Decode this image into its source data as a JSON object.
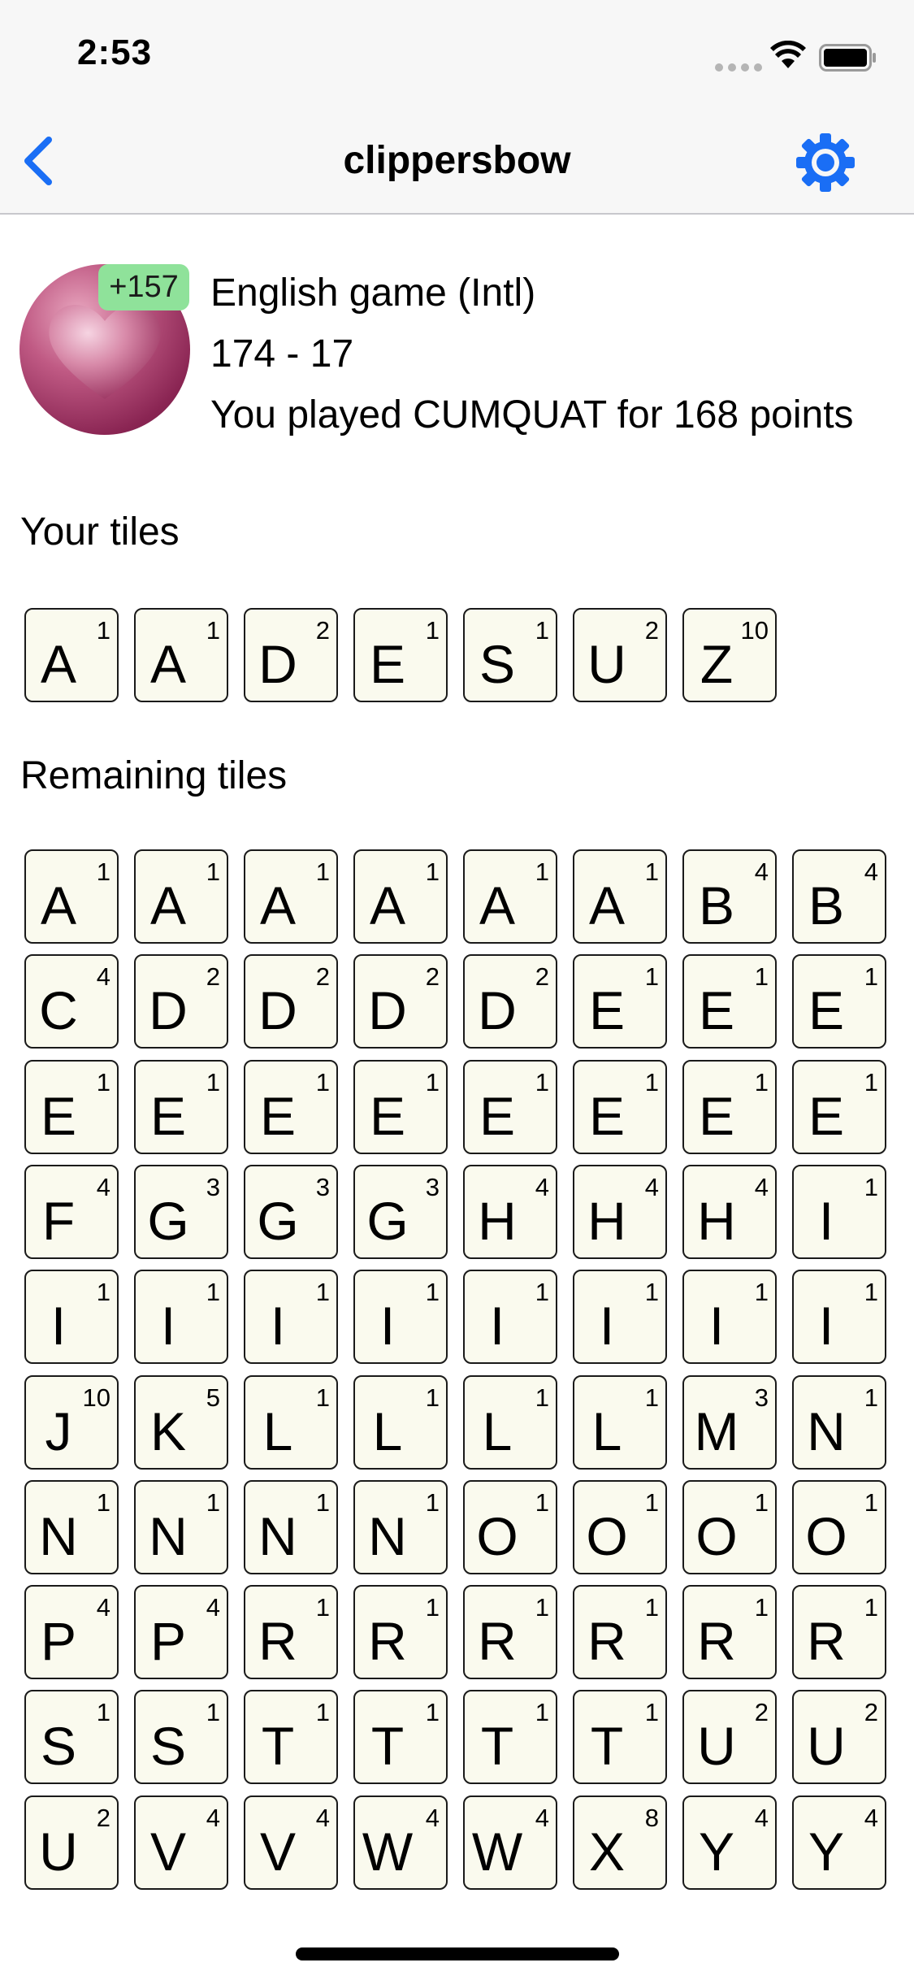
{
  "status_bar": {
    "time": "2:53"
  },
  "nav": {
    "title": "clippersbow",
    "back_icon": "chevron-left-icon",
    "settings_icon": "gear-icon"
  },
  "colors": {
    "accent": "#1a6ef5",
    "badge": "#8fe29a",
    "tile_bg": "#fafaee"
  },
  "game": {
    "score_delta": "+157",
    "name": "English game (Intl)",
    "score": "174 - 17",
    "last_move": "You played CUMQUAT for 168 points"
  },
  "your_tiles": {
    "heading": "Your tiles",
    "tiles": [
      {
        "letter": "A",
        "value": "1"
      },
      {
        "letter": "A",
        "value": "1"
      },
      {
        "letter": "D",
        "value": "2"
      },
      {
        "letter": "E",
        "value": "1"
      },
      {
        "letter": "S",
        "value": "1"
      },
      {
        "letter": "U",
        "value": "2"
      },
      {
        "letter": "Z",
        "value": "10"
      }
    ]
  },
  "remaining_tiles": {
    "heading": "Remaining tiles",
    "tiles": [
      {
        "letter": "A",
        "value": "1"
      },
      {
        "letter": "A",
        "value": "1"
      },
      {
        "letter": "A",
        "value": "1"
      },
      {
        "letter": "A",
        "value": "1"
      },
      {
        "letter": "A",
        "value": "1"
      },
      {
        "letter": "A",
        "value": "1"
      },
      {
        "letter": "B",
        "value": "4"
      },
      {
        "letter": "B",
        "value": "4"
      },
      {
        "letter": "C",
        "value": "4"
      },
      {
        "letter": "D",
        "value": "2"
      },
      {
        "letter": "D",
        "value": "2"
      },
      {
        "letter": "D",
        "value": "2"
      },
      {
        "letter": "D",
        "value": "2"
      },
      {
        "letter": "E",
        "value": "1"
      },
      {
        "letter": "E",
        "value": "1"
      },
      {
        "letter": "E",
        "value": "1"
      },
      {
        "letter": "E",
        "value": "1"
      },
      {
        "letter": "E",
        "value": "1"
      },
      {
        "letter": "E",
        "value": "1"
      },
      {
        "letter": "E",
        "value": "1"
      },
      {
        "letter": "E",
        "value": "1"
      },
      {
        "letter": "E",
        "value": "1"
      },
      {
        "letter": "E",
        "value": "1"
      },
      {
        "letter": "E",
        "value": "1"
      },
      {
        "letter": "F",
        "value": "4"
      },
      {
        "letter": "G",
        "value": "3"
      },
      {
        "letter": "G",
        "value": "3"
      },
      {
        "letter": "G",
        "value": "3"
      },
      {
        "letter": "H",
        "value": "4"
      },
      {
        "letter": "H",
        "value": "4"
      },
      {
        "letter": "H",
        "value": "4"
      },
      {
        "letter": "I",
        "value": "1"
      },
      {
        "letter": "I",
        "value": "1"
      },
      {
        "letter": "I",
        "value": "1"
      },
      {
        "letter": "I",
        "value": "1"
      },
      {
        "letter": "I",
        "value": "1"
      },
      {
        "letter": "I",
        "value": "1"
      },
      {
        "letter": "I",
        "value": "1"
      },
      {
        "letter": "I",
        "value": "1"
      },
      {
        "letter": "I",
        "value": "1"
      },
      {
        "letter": "J",
        "value": "10"
      },
      {
        "letter": "K",
        "value": "5"
      },
      {
        "letter": "L",
        "value": "1"
      },
      {
        "letter": "L",
        "value": "1"
      },
      {
        "letter": "L",
        "value": "1"
      },
      {
        "letter": "L",
        "value": "1"
      },
      {
        "letter": "M",
        "value": "3"
      },
      {
        "letter": "N",
        "value": "1"
      },
      {
        "letter": "N",
        "value": "1"
      },
      {
        "letter": "N",
        "value": "1"
      },
      {
        "letter": "N",
        "value": "1"
      },
      {
        "letter": "N",
        "value": "1"
      },
      {
        "letter": "O",
        "value": "1"
      },
      {
        "letter": "O",
        "value": "1"
      },
      {
        "letter": "O",
        "value": "1"
      },
      {
        "letter": "O",
        "value": "1"
      },
      {
        "letter": "P",
        "value": "4"
      },
      {
        "letter": "P",
        "value": "4"
      },
      {
        "letter": "R",
        "value": "1"
      },
      {
        "letter": "R",
        "value": "1"
      },
      {
        "letter": "R",
        "value": "1"
      },
      {
        "letter": "R",
        "value": "1"
      },
      {
        "letter": "R",
        "value": "1"
      },
      {
        "letter": "R",
        "value": "1"
      },
      {
        "letter": "S",
        "value": "1"
      },
      {
        "letter": "S",
        "value": "1"
      },
      {
        "letter": "T",
        "value": "1"
      },
      {
        "letter": "T",
        "value": "1"
      },
      {
        "letter": "T",
        "value": "1"
      },
      {
        "letter": "T",
        "value": "1"
      },
      {
        "letter": "U",
        "value": "2"
      },
      {
        "letter": "U",
        "value": "2"
      },
      {
        "letter": "U",
        "value": "2"
      },
      {
        "letter": "V",
        "value": "4"
      },
      {
        "letter": "V",
        "value": "4"
      },
      {
        "letter": "W",
        "value": "4"
      },
      {
        "letter": "W",
        "value": "4"
      },
      {
        "letter": "X",
        "value": "8"
      },
      {
        "letter": "Y",
        "value": "4"
      },
      {
        "letter": "Y",
        "value": "4"
      }
    ]
  }
}
